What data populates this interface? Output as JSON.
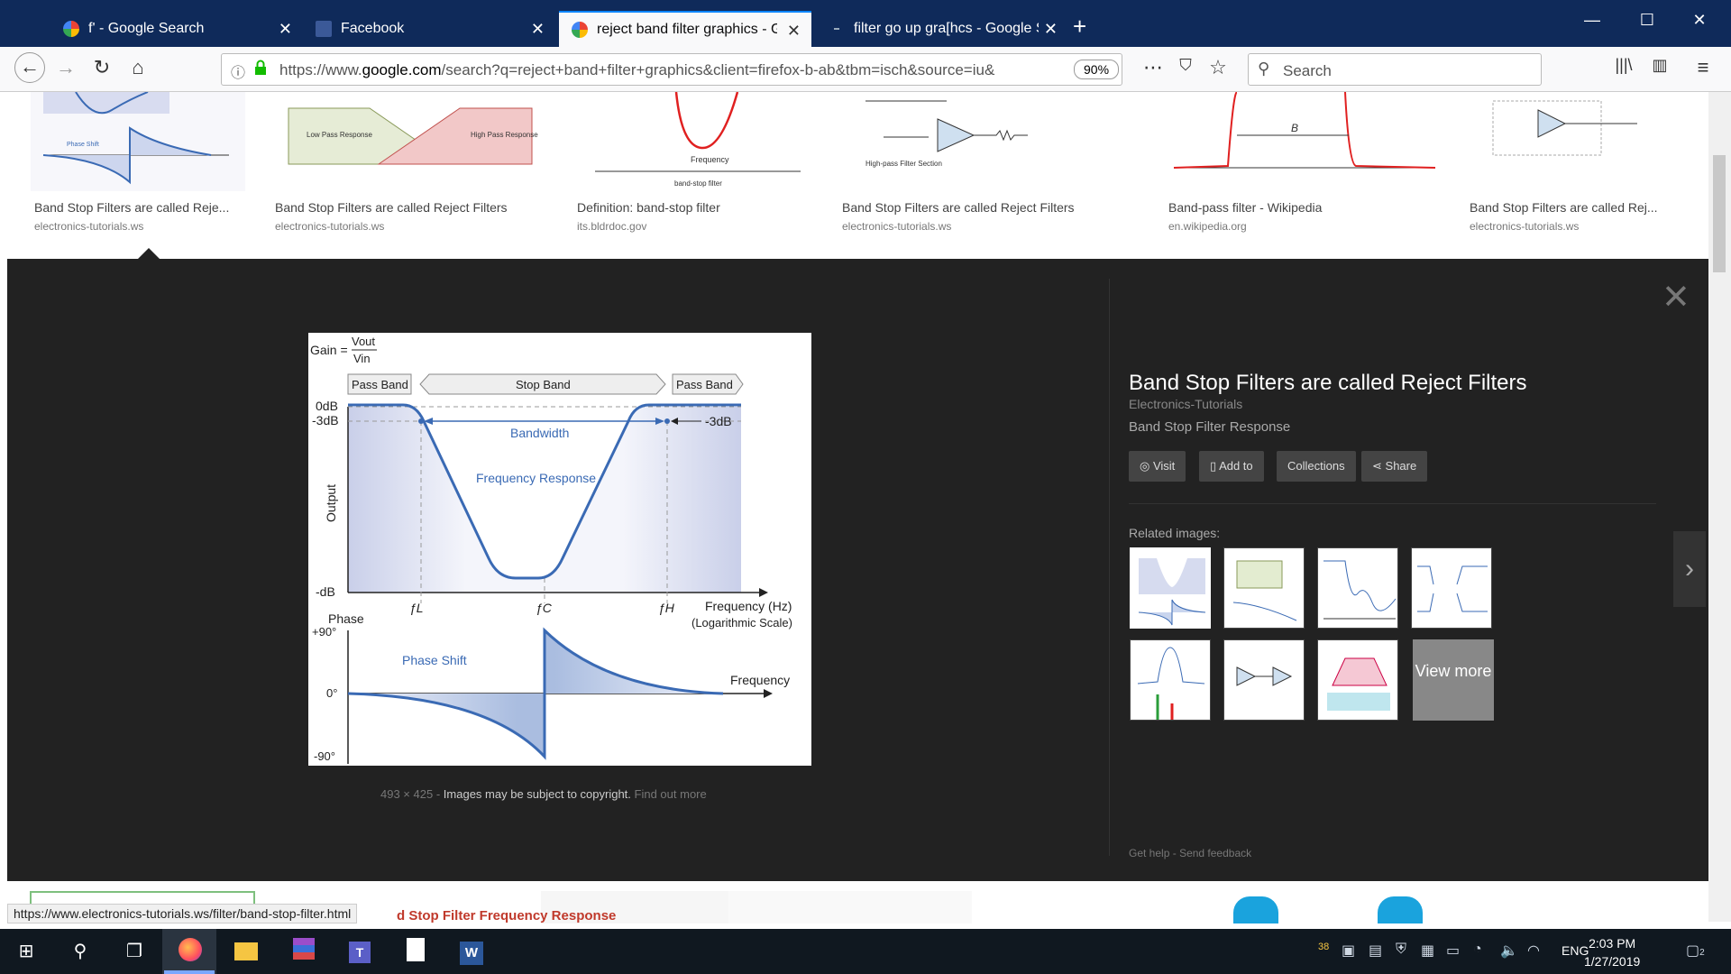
{
  "tabs": [
    {
      "title": "f' - Google Search",
      "icon": "google-icon",
      "active": false
    },
    {
      "title": "Facebook",
      "icon": "facebook-icon",
      "active": false
    },
    {
      "title": "reject band filter graphics - Go",
      "icon": "google-icon",
      "active": true
    },
    {
      "title": "filter go up gra[hcs - Google Se",
      "icon": "loading-icon",
      "active": false
    }
  ],
  "nav": {
    "url_prefix": "https://www.",
    "url_domain": "google.com",
    "url_rest": "/search?q=reject+band+filter+graphics&client=firefox-b-ab&tbm=isch&source=iu&",
    "zoom": "90%",
    "search_placeholder": "Search"
  },
  "thumbs": [
    {
      "caption": "Band Stop Filters are called Reje...",
      "source": "electronics-tutorials.ws"
    },
    {
      "caption": "Band Stop Filters are called Reject Filters",
      "source": "electronics-tutorials.ws"
    },
    {
      "caption": "Definition: band-stop filter",
      "source": "its.bldrdoc.gov"
    },
    {
      "caption": "Band Stop Filters are called Reject Filters",
      "source": "electronics-tutorials.ws"
    },
    {
      "caption": "Band-pass filter - Wikipedia",
      "source": "en.wikipedia.org"
    },
    {
      "caption": "Band Stop Filters are called Rej...",
      "source": "electronics-tutorials.ws"
    }
  ],
  "thumb_labels": {
    "t1_phase_shift": "Phase Shift",
    "t2_lowpass": "Low Pass Response",
    "t2_highpass": "High Pass Response",
    "t3_frequency": "Frequency",
    "t3_caption": "band-stop filter",
    "t4_hp": "High-pass Filter Section",
    "t5_b": "B"
  },
  "preview": {
    "title": "Band Stop Filters are called Reject Filters",
    "site": "Electronics-Tutorials",
    "desc": "Band Stop Filter Response",
    "buttons": [
      "Visit",
      "Add to",
      "Collections",
      "Share"
    ],
    "related_label": "Related images:",
    "view_more": "View more",
    "dims": "493 × 425",
    "sep": "-",
    "copyright": "Images may be subject to copyright.",
    "find_out_more": "Find out more",
    "get_help": "Get help",
    "send_feedback": "Send feedback"
  },
  "figure": {
    "gain_label": "Gain =",
    "vout": "Vout",
    "vin": "Vin",
    "pass_band_left": "Pass Band",
    "stop_band": "Stop Band",
    "pass_band_right": "Pass Band",
    "db0": "0dB",
    "db3": "-3dB",
    "db3_right": "-3dB",
    "dbmin": "-dB",
    "bandwidth": "Bandwidth",
    "freq_response": "Frequency Response",
    "output": "Output",
    "fl": "ƒL",
    "fc": "ƒC",
    "fh": "ƒH",
    "freq_hz": "Frequency (Hz)",
    "log_scale": "(Logarithmic Scale)",
    "phase": "Phase",
    "p90": "+90°",
    "p0": "0°",
    "m90": "-90°",
    "phase_shift": "Phase Shift",
    "frequency": "Frequency"
  },
  "bottom": {
    "status_url": "https://www.electronics-tutorials.ws/filter/band-stop-filter.html",
    "caption": "d Stop Filter Frequency Response"
  },
  "taskbar": {
    "time": "2:03 PM",
    "date": "1/27/2019",
    "lang": "ENG",
    "temp": "38",
    "notif": "2"
  },
  "colors": {
    "accent": "#0a84ff",
    "curve": "#3a6ab4",
    "fill": "#cdd3ec",
    "panel": "#222222"
  }
}
